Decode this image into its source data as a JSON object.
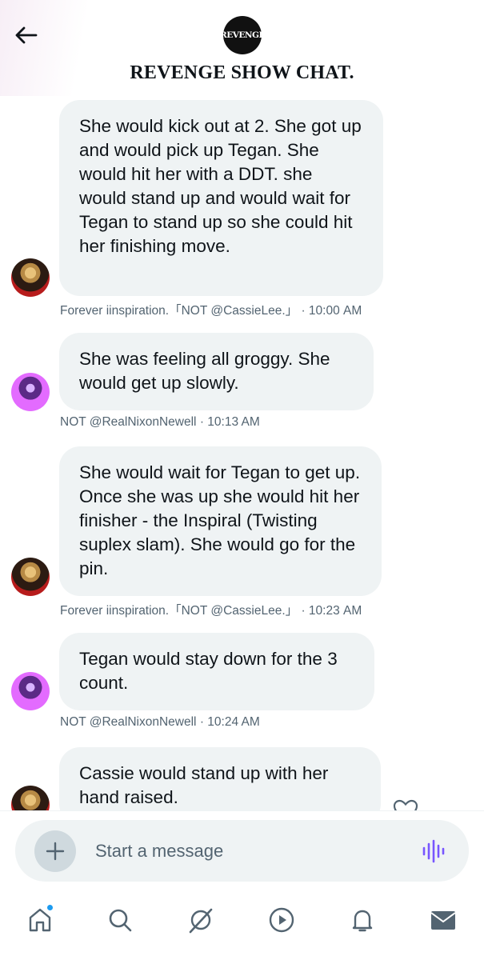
{
  "header": {
    "logo_text": "REVENGE",
    "title": "REVENGE SHOW CHAT."
  },
  "messages": [
    {
      "text": "She would kick out at 2. She got up and would pick up Tegan. She would hit her with a DDT. she would stand up and would wait for Tegan to stand up so she could hit her finishing move.",
      "author": "Forever iinspiration.「NOT @CassieLee.」",
      "time": "10:00 AM",
      "avatar": "cassie-avatar"
    },
    {
      "text": "She was feeling all groggy. She would get up slowly.",
      "author": "NOT @RealNixonNewell",
      "time": "10:13 AM",
      "avatar": "nixon-avatar"
    },
    {
      "text": "She would wait for Tegan to get up. Once she was up she would hit her finisher - the Inspiral (Twisting suplex slam). She would go for the pin.",
      "author": "Forever iinspiration.「NOT @CassieLee.」",
      "time": "10:23 AM",
      "avatar": "cassie-avatar"
    },
    {
      "text": "Tegan would stay down for the 3 count.",
      "author": "NOT @RealNixonNewell",
      "time": "10:24 AM",
      "avatar": "nixon-avatar"
    },
    {
      "text": "Cassie would stand up with her hand raised.",
      "author": "",
      "time": "",
      "avatar": "cassie-avatar"
    }
  ],
  "composer": {
    "placeholder": "Start a message"
  },
  "colors": {
    "bubble": "#eff3f4",
    "meta_text": "#536471",
    "accent_voice": "#7856ff",
    "notification_dot": "#1d9bf0"
  },
  "tabs": [
    "home-icon",
    "search-icon",
    "grok-icon",
    "video-icon",
    "notifications-icon",
    "messages-icon"
  ]
}
